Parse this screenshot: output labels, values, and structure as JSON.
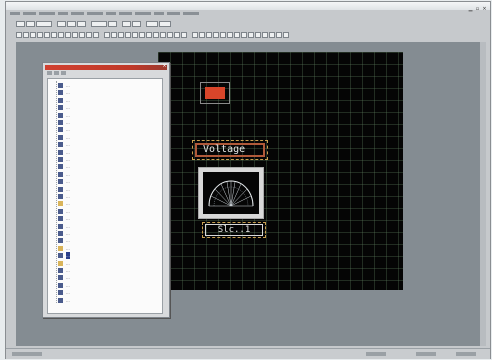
{
  "canvas": {
    "label_main": "Voltage",
    "label_tag": "Slc..1",
    "colors": {
      "background": "#050505",
      "button": "#d9452a",
      "grid": "#5a785a"
    }
  },
  "panel": {
    "tree_rows": [
      {
        "label": "...",
        "kind": "item"
      },
      {
        "label": "...",
        "kind": "item"
      },
      {
        "label": "...",
        "kind": "item"
      },
      {
        "label": "...",
        "kind": "item"
      },
      {
        "label": "...",
        "kind": "item"
      },
      {
        "label": "...",
        "kind": "item"
      },
      {
        "label": "...",
        "kind": "item"
      },
      {
        "label": "...",
        "kind": "item"
      },
      {
        "label": "...",
        "kind": "item"
      },
      {
        "label": "...",
        "kind": "item"
      },
      {
        "label": "...",
        "kind": "item"
      },
      {
        "label": "...",
        "kind": "item"
      },
      {
        "label": "...",
        "kind": "item"
      },
      {
        "label": "...",
        "kind": "item"
      },
      {
        "label": "...",
        "kind": "item"
      },
      {
        "label": "...",
        "kind": "item"
      },
      {
        "label": "...",
        "kind": "folder"
      },
      {
        "label": "...",
        "kind": "item"
      },
      {
        "label": "...",
        "kind": "item"
      },
      {
        "label": "...",
        "kind": "item"
      },
      {
        "label": "...",
        "kind": "item"
      },
      {
        "label": "...",
        "kind": "item"
      },
      {
        "label": "...",
        "kind": "folder"
      },
      {
        "label": "...",
        "kind": "selected"
      },
      {
        "label": "...",
        "kind": "folder"
      },
      {
        "label": "...",
        "kind": "item"
      },
      {
        "label": "...",
        "kind": "item"
      },
      {
        "label": "...",
        "kind": "item"
      },
      {
        "label": "...",
        "kind": "item"
      },
      {
        "label": "...",
        "kind": "item"
      }
    ]
  },
  "icons": {
    "tree_item": "object-icon",
    "tree_folder": "folder-icon",
    "close": "close-icon",
    "gauge": "gauge-icon"
  }
}
